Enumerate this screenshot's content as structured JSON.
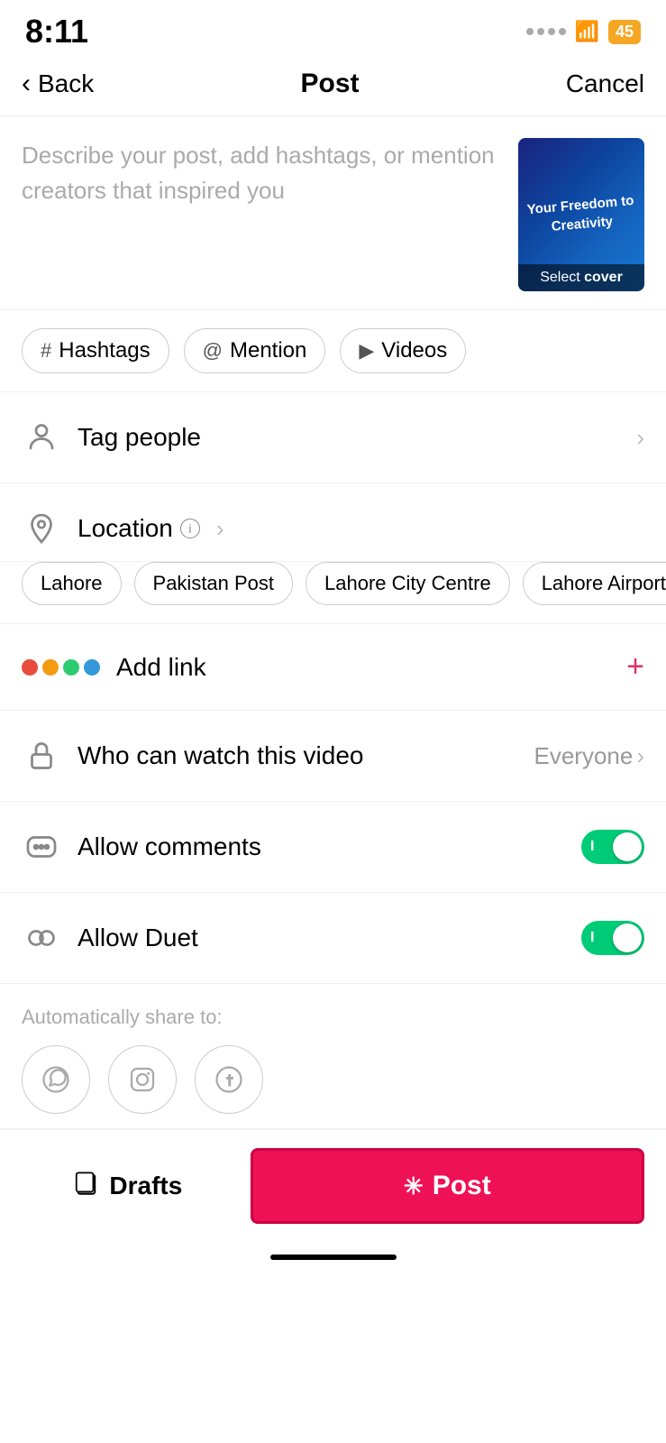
{
  "status": {
    "time": "8:11",
    "battery": "45"
  },
  "header": {
    "back_label": "Back",
    "title": "Post",
    "cancel_label": "Cancel"
  },
  "post": {
    "placeholder": "Describe your post, add hashtags, or mention creators that inspired you",
    "thumbnail_text": "Your Freedom to Creativity",
    "select_cover": "Select cover"
  },
  "buttons": {
    "hashtags": "Hashtags",
    "mention": "Mention",
    "videos": "Videos"
  },
  "tag_people": {
    "label": "Tag people"
  },
  "location": {
    "label": "Location",
    "info_icon": "i",
    "tags": [
      "Lahore",
      "Pakistan Post",
      "Lahore City Centre",
      "Lahore Airport Par"
    ]
  },
  "add_link": {
    "label": "Add link",
    "plus": "+"
  },
  "who_can_watch": {
    "label": "Who can watch this video",
    "value": "Everyone"
  },
  "allow_comments": {
    "label": "Allow comments"
  },
  "allow_duet": {
    "label": "Allow Duet"
  },
  "share": {
    "label": "Automatically share to:"
  },
  "bottom": {
    "drafts_icon": "⬜",
    "drafts_label": "Drafts",
    "post_icon": "✳",
    "post_label": "Post"
  },
  "colors": {
    "accent_red": "#ee1155",
    "toggle_green": "#00cc77"
  }
}
